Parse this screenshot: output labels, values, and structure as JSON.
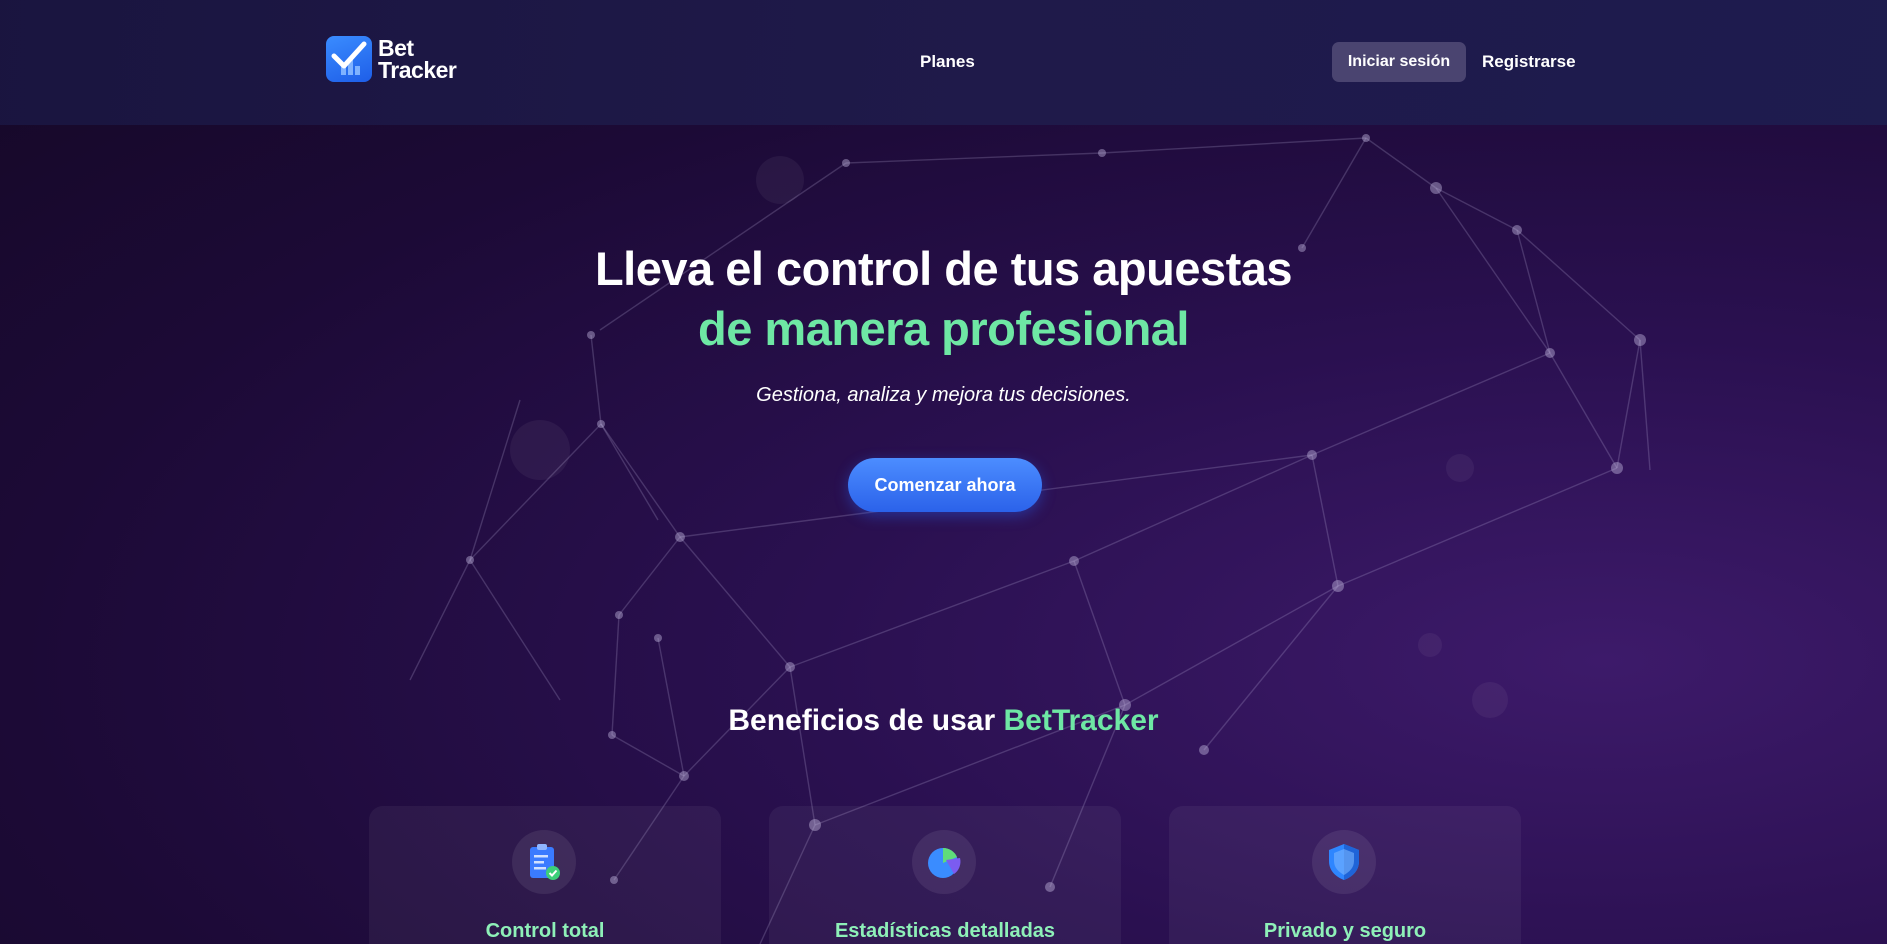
{
  "header": {
    "logo": {
      "line1": "Bet",
      "line2": "Tracker"
    },
    "nav_planes": "Planes",
    "login_label": "Iniciar sesión",
    "register_label": "Registrarse"
  },
  "hero": {
    "title_line1": "Lleva el control de tus apuestas",
    "title_line2": "de manera profesional",
    "subtitle": "Gestiona, analiza y mejora tus decisiones.",
    "cta_label": "Comenzar ahora"
  },
  "benefits": {
    "title_prefix": "Beneficios de usar ",
    "title_accent": "BetTracker",
    "cards": [
      {
        "title": "Control total",
        "icon": "clipboard-check-icon"
      },
      {
        "title": "Estadísticas detalladas",
        "icon": "pie-chart-icon"
      },
      {
        "title": "Privado y seguro",
        "icon": "shield-icon"
      }
    ]
  },
  "colors": {
    "accent_green": "#6ee7a4",
    "primary_blue": "#2b62ea",
    "background": "#1c0a36"
  }
}
